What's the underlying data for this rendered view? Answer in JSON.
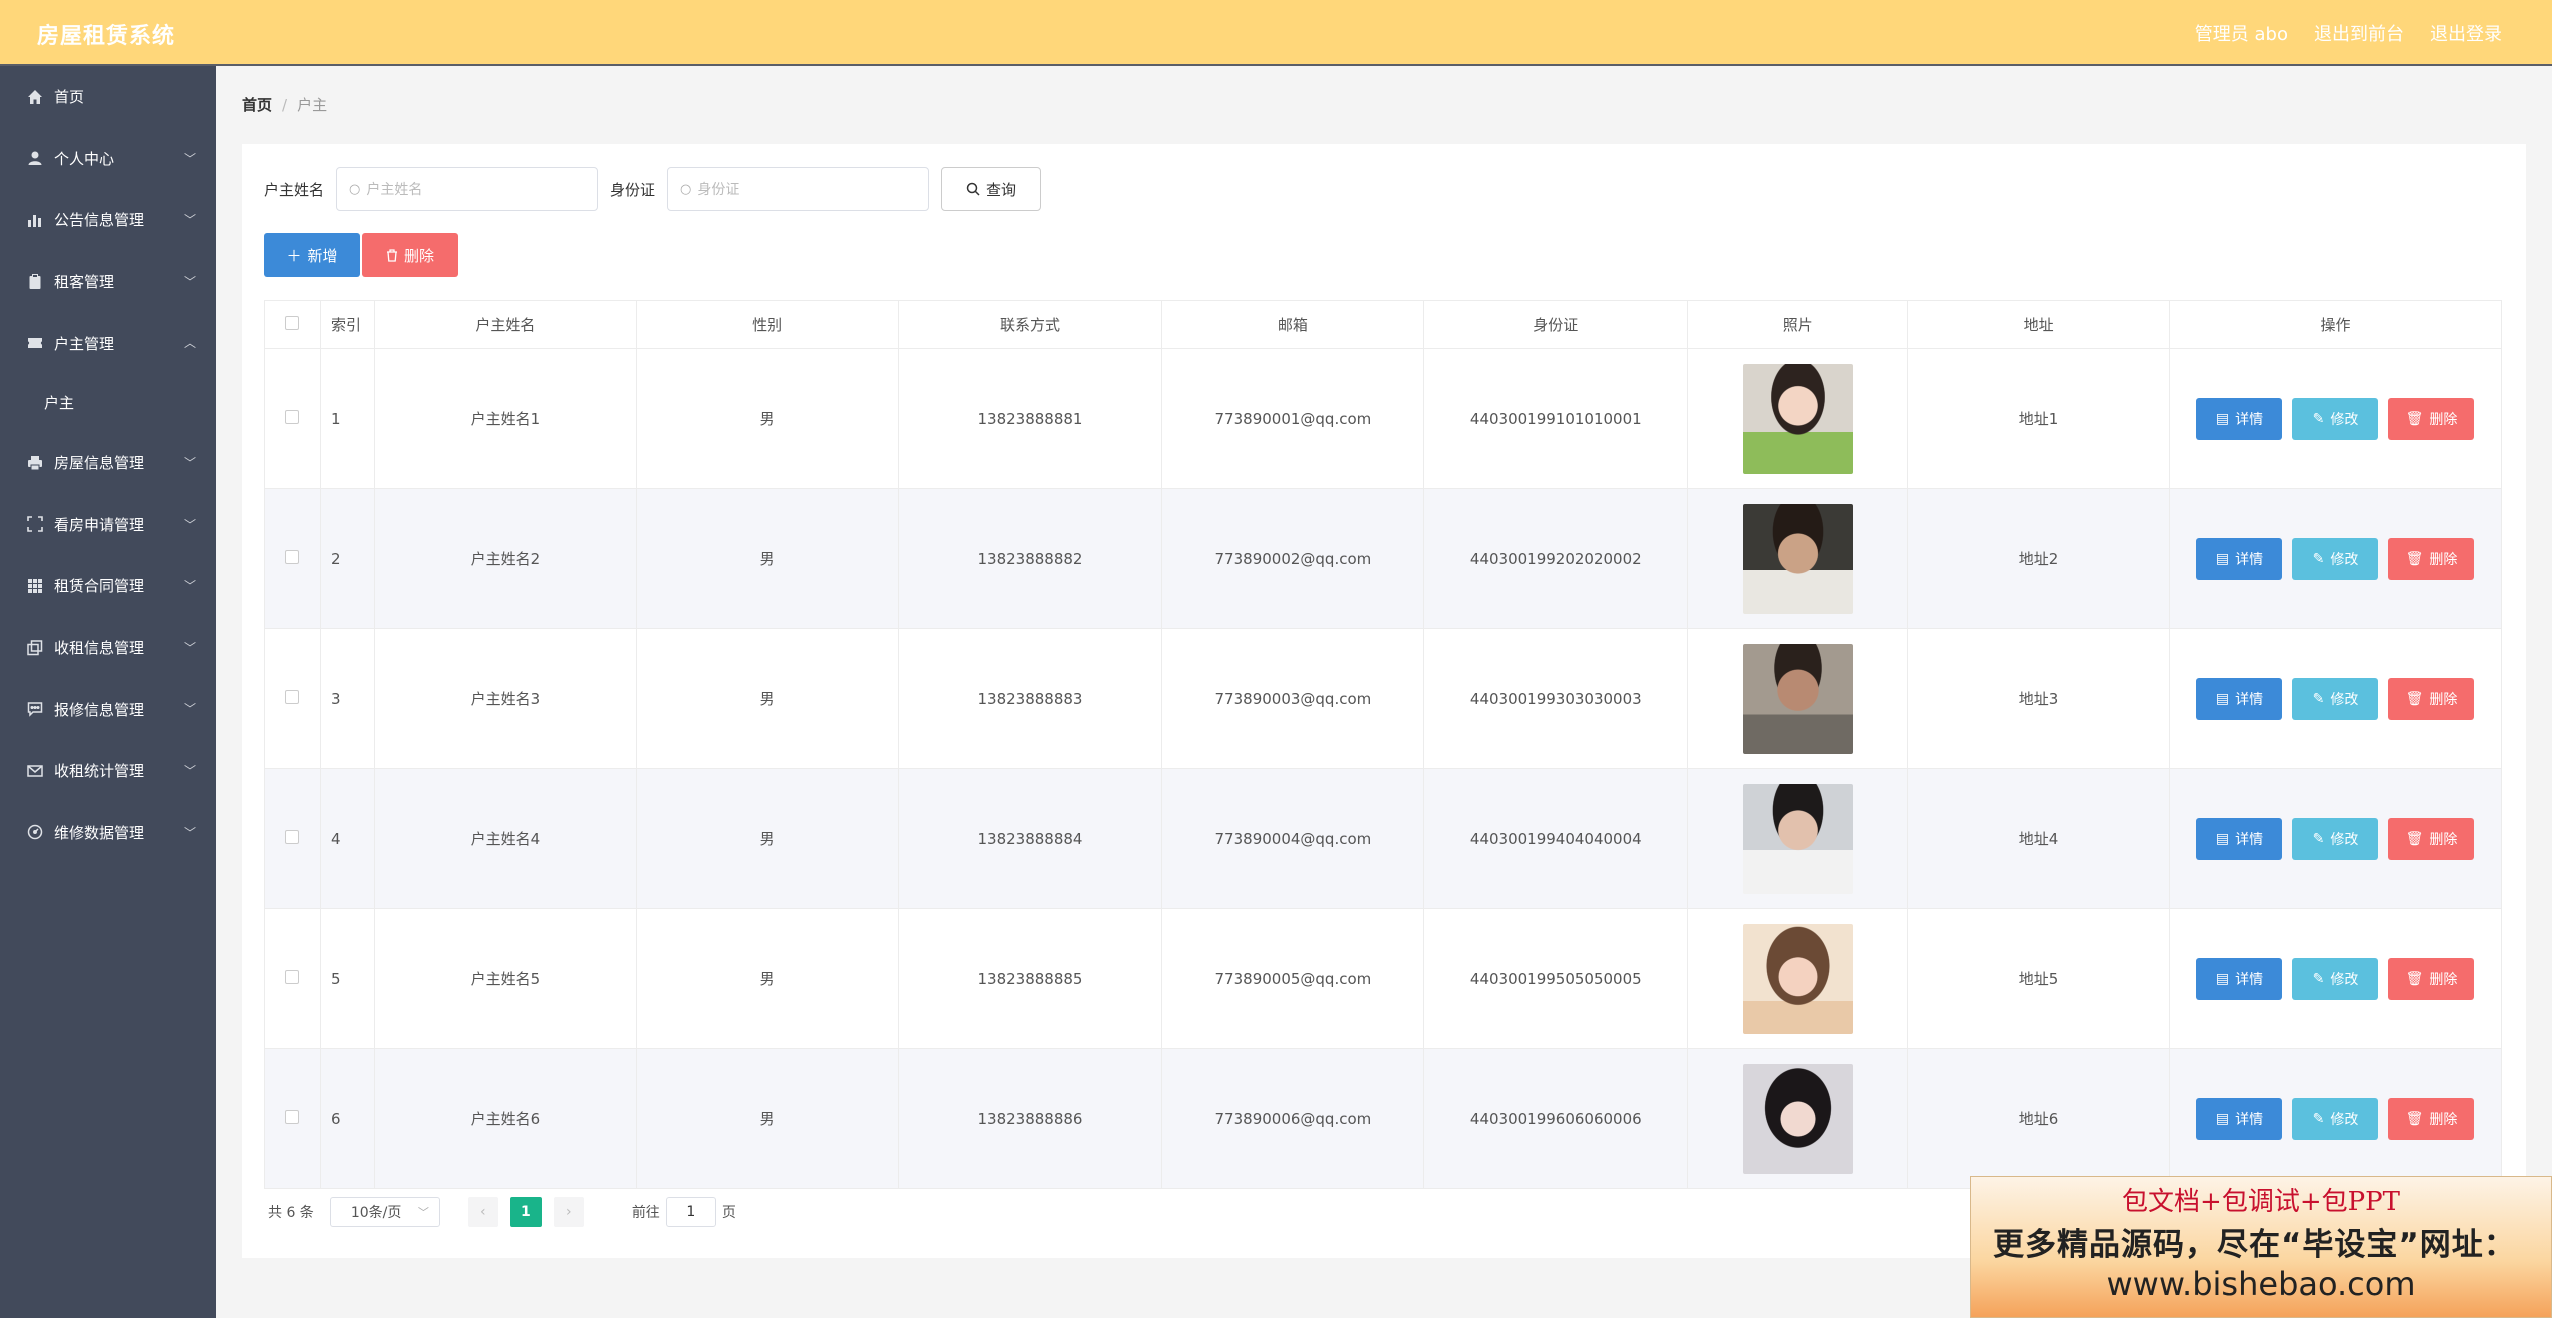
{
  "app": {
    "title": "房屋租赁系统"
  },
  "topbar": {
    "admin": "管理员 abo",
    "back_to_front": "退出到前台",
    "logout": "退出登录"
  },
  "sidebar": {
    "items": [
      {
        "label": "首页",
        "icon": "home-icon"
      },
      {
        "label": "个人中心",
        "icon": "user-icon"
      },
      {
        "label": "公告信息管理",
        "icon": "bar-chart-icon"
      },
      {
        "label": "租客管理",
        "icon": "clipboard-icon"
      },
      {
        "label": "户主管理",
        "icon": "ticket-icon"
      },
      {
        "label": "户主",
        "icon": ""
      },
      {
        "label": "房屋信息管理",
        "icon": "printer-icon"
      },
      {
        "label": "看房申请管理",
        "icon": "scan-icon"
      },
      {
        "label": "租赁合同管理",
        "icon": "grid-icon"
      },
      {
        "label": "收租信息管理",
        "icon": "copy-icon"
      },
      {
        "label": "报修信息管理",
        "icon": "chat-icon"
      },
      {
        "label": "收租统计管理",
        "icon": "mail-icon"
      },
      {
        "label": "维修数据管理",
        "icon": "dashboard-icon"
      }
    ]
  },
  "breadcrumb": {
    "home": "首页",
    "current": "户主"
  },
  "search": {
    "name_label": "户主姓名",
    "name_placeholder": "户主姓名",
    "id_label": "身份证",
    "id_placeholder": "身份证",
    "query_button": "查询"
  },
  "actions": {
    "add": "新增",
    "delete": "删除"
  },
  "table": {
    "headers": [
      "索引",
      "户主姓名",
      "性别",
      "联系方式",
      "邮箱",
      "身份证",
      "照片",
      "地址",
      "操作"
    ],
    "rows": [
      {
        "index": "1",
        "name": "户主姓名1",
        "gender": "男",
        "phone": "13823888881",
        "email": "773890001@qq.com",
        "id_card": "440300199101010001",
        "address": "地址1"
      },
      {
        "index": "2",
        "name": "户主姓名2",
        "gender": "男",
        "phone": "13823888882",
        "email": "773890002@qq.com",
        "id_card": "440300199202020002",
        "address": "地址2"
      },
      {
        "index": "3",
        "name": "户主姓名3",
        "gender": "男",
        "phone": "13823888883",
        "email": "773890003@qq.com",
        "id_card": "440300199303030003",
        "address": "地址3"
      },
      {
        "index": "4",
        "name": "户主姓名4",
        "gender": "男",
        "phone": "13823888884",
        "email": "773890004@qq.com",
        "id_card": "440300199404040004",
        "address": "地址4"
      },
      {
        "index": "5",
        "name": "户主姓名5",
        "gender": "男",
        "phone": "13823888885",
        "email": "773890005@qq.com",
        "id_card": "440300199505050005",
        "address": "地址5"
      },
      {
        "index": "6",
        "name": "户主姓名6",
        "gender": "男",
        "phone": "13823888886",
        "email": "773890006@qq.com",
        "id_card": "440300199606060006",
        "address": "地址6"
      }
    ],
    "ops": {
      "detail": "详情",
      "edit": "修改",
      "remove": "删除"
    }
  },
  "pager": {
    "total": "共 6 条",
    "page_size": "10条/页",
    "current": "1",
    "goto_prefix": "前往",
    "goto_value": "1",
    "goto_suffix": "页"
  },
  "promo": {
    "line1": "包文档+包调试+包PPT",
    "line2": "更多精品源码，尽在“毕设宝”网址：",
    "line3": "www.bishebao.com"
  },
  "colors": {
    "topbar": "#ffd77a",
    "sidebar": "#424a5b",
    "primary": "#3c8ad8",
    "info": "#5bc0de",
    "danger": "#f56c6c",
    "pager_active": "#19b48a"
  }
}
